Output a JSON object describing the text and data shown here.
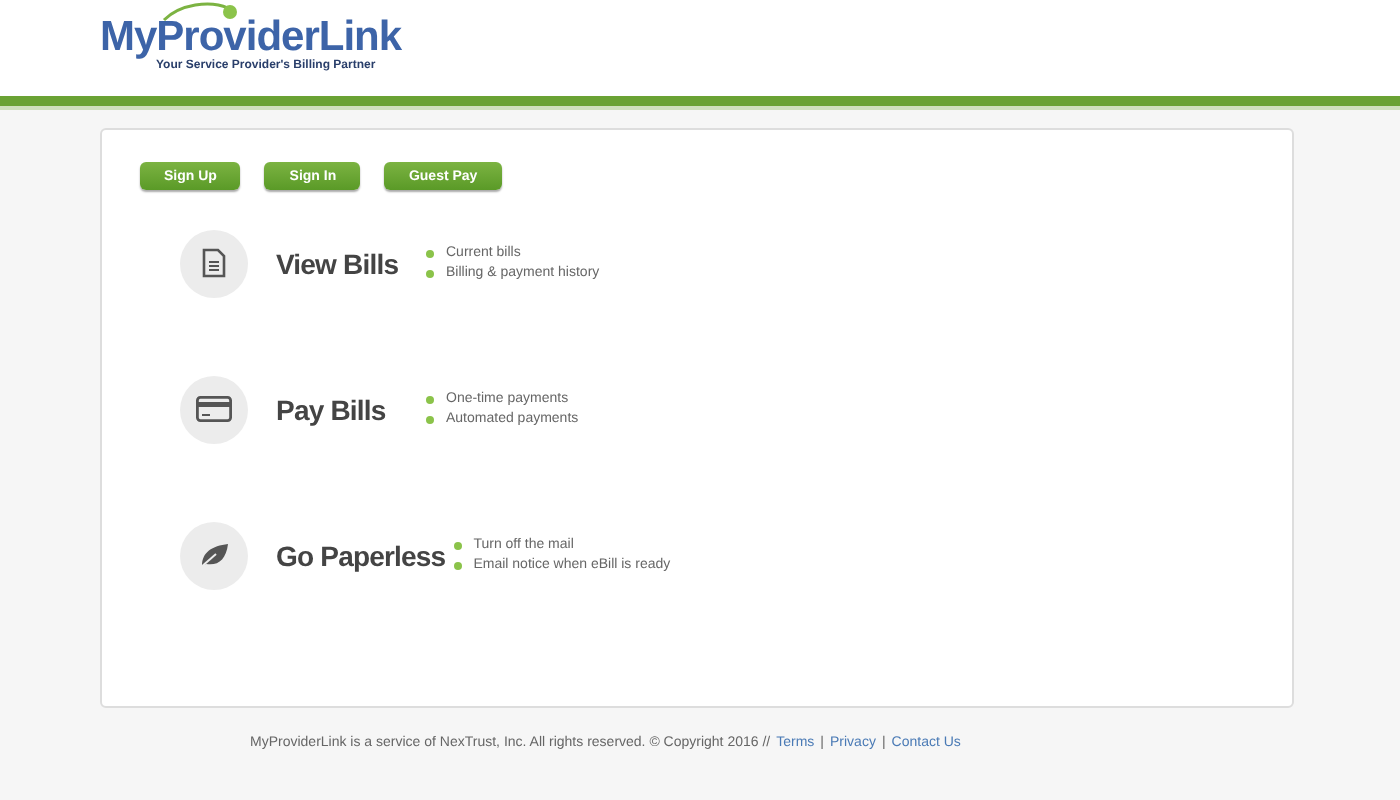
{
  "logo": {
    "name": "MyProviderLink",
    "tagline": "Your Service Provider's Billing Partner"
  },
  "buttons": [
    "Sign Up",
    "Sign In",
    "Guest Pay"
  ],
  "features": [
    {
      "kind": "document",
      "title": "View Bills",
      "bullets": [
        "Current bills",
        "Billing & payment history"
      ]
    },
    {
      "kind": "card",
      "title": "Pay Bills",
      "bullets": [
        "One-time payments",
        "Automated payments"
      ]
    },
    {
      "kind": "leaf",
      "title": "Go Paperless",
      "bullets": [
        "Turn off the mail",
        "Email notice when eBill is ready"
      ]
    }
  ],
  "footer": {
    "text": "MyProviderLink is a service of NexTrust, Inc. All rights reserved. © Copyright 2016 //",
    "separator": "|",
    "links": [
      "Terms",
      "Privacy",
      "Contact Us"
    ]
  }
}
